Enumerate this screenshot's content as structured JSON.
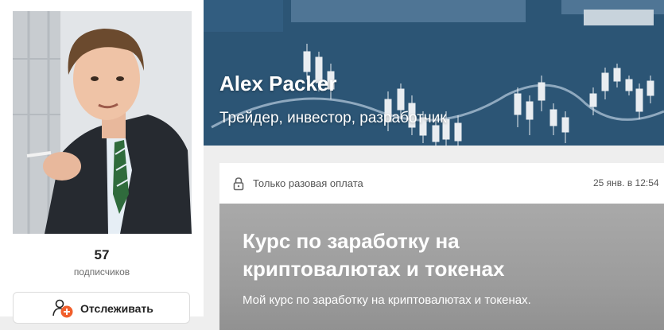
{
  "profile": {
    "subscriber_count": "57",
    "subscriber_label": "подписчиков",
    "follow_label": "Отслеживать",
    "follow_icon": "user-plus-icon",
    "accent": "#f15f2c"
  },
  "cover": {
    "name": "Alex Packer",
    "tagline": "Трейдер, инвестор, разработчик"
  },
  "post": {
    "access_label": "Только разовая оплата",
    "access_icon": "lock-icon",
    "date": "25 янв. в 12:54",
    "title": "Курс по заработку на криптовалютах и токенах",
    "description": "Мой курс по заработку на криптовалютах и токенах."
  }
}
